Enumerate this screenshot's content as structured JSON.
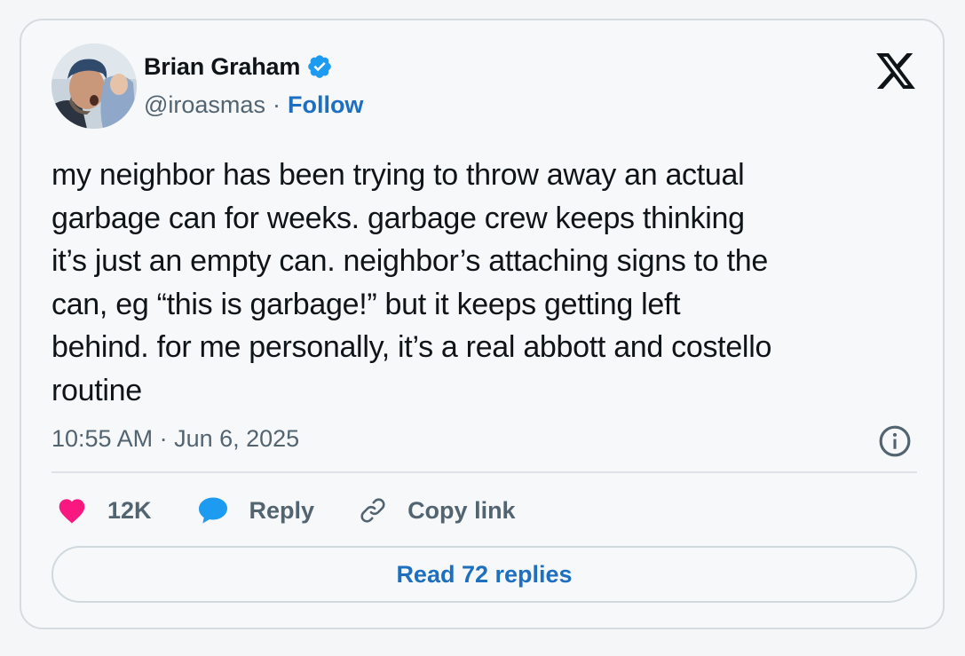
{
  "author": {
    "name": "Brian Graham",
    "handle": "@iroasmas",
    "separator": "·",
    "follow_label": "Follow"
  },
  "tweet": {
    "text": "my neighbor has been trying to throw away an actual\ngarbage can for weeks. garbage crew keeps thinking\nit’s just an empty can. neighbor’s attaching signs to the\ncan, eg “this is garbage!” but it keeps getting left\nbehind. for me personally, it’s a real abbott and costello\nroutine",
    "timestamp": "10:55 AM · Jun 6, 2025"
  },
  "actions": {
    "like_count": "12K",
    "reply_label": "Reply",
    "copy_label": "Copy link"
  },
  "read_replies_label": "Read 72 replies",
  "icons": {
    "verified": "verified-badge-icon",
    "x_logo": "x-logo-icon",
    "info": "info-icon",
    "heart": "heart-icon",
    "reply": "speech-bubble-icon",
    "link": "link-icon"
  },
  "colors": {
    "link_blue": "#1d6fc0",
    "verified_blue": "#1d9bf0",
    "heart_pink": "#f91880",
    "text": "#0f1419",
    "muted": "#536471"
  }
}
